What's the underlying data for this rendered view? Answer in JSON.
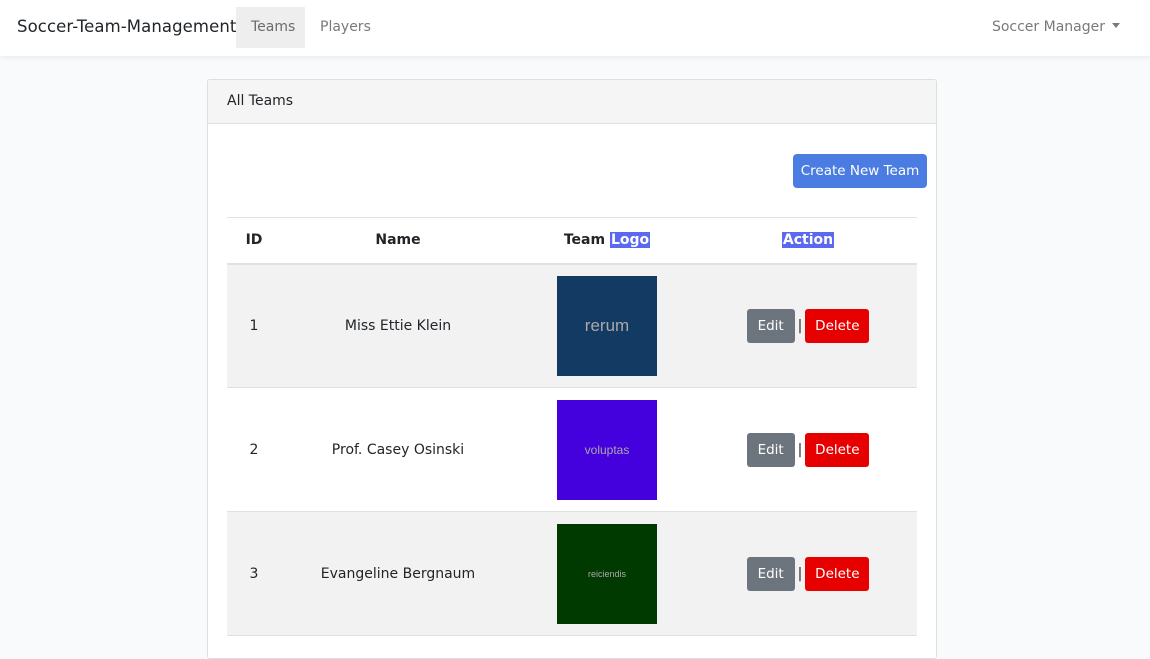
{
  "navbar": {
    "brand": "Soccer-Team-Management",
    "links": [
      {
        "label": "Teams",
        "active": true
      },
      {
        "label": "Players",
        "active": false
      }
    ],
    "user_menu": "Soccer Manager"
  },
  "card": {
    "header": "All Teams",
    "create_button": "Create New Team"
  },
  "table": {
    "columns": {
      "id": "ID",
      "name": "Name",
      "logo_prefix": "Team",
      "logo_highlight": "Logo",
      "action": "Action"
    },
    "rows": [
      {
        "id": "1",
        "name": "Miss Ettie Klein",
        "logo_text": "rerum",
        "logo_bg": "#133a63",
        "logo_size": "17px"
      },
      {
        "id": "2",
        "name": "Prof. Casey Osinski",
        "logo_text": "voluptas",
        "logo_bg": "#4400dd",
        "logo_size": "12px"
      },
      {
        "id": "3",
        "name": "Evangeline Bergnaum",
        "logo_text": "reiciendis",
        "logo_bg": "#003a00",
        "logo_size": "9px"
      }
    ],
    "edit_label": "Edit",
    "delete_label": "Delete",
    "separator": "|"
  },
  "colors": {
    "primary": "#4a7ce2",
    "secondary": "#6c757d",
    "danger": "#e60000",
    "highlight": "#5b69f0"
  }
}
